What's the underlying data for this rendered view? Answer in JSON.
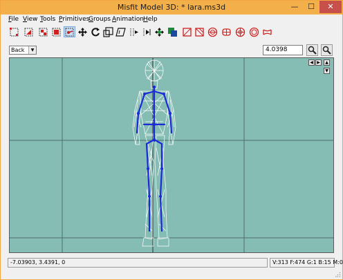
{
  "window": {
    "title": "Misfit Model 3D: * lara.ms3d",
    "controls": {
      "minimize": "—",
      "maximize": "☐",
      "close": "✕"
    }
  },
  "menu": {
    "items": [
      {
        "mn": "F",
        "rest": "ile"
      },
      {
        "mn": "V",
        "rest": "iew"
      },
      {
        "mn": "T",
        "rest": "ools"
      },
      {
        "mn": "P",
        "rest": "rimitives"
      },
      {
        "mn": "G",
        "rest": "roups"
      },
      {
        "mn": "A",
        "rest": "nimation"
      },
      {
        "mn": "H",
        "rest": "elp"
      }
    ]
  },
  "toolbar": {
    "tools": [
      "select-vertices-icon",
      "select-faces-icon",
      "select-connected-icon",
      "select-groups-icon",
      "select-bone-joints-icon",
      "move-icon",
      "rotate-icon",
      "scale-icon",
      "shear-icon",
      "extrude-icon",
      "attach-icon",
      "joint-icon",
      "rect-icon",
      "cube-icon",
      "ellipse-icon",
      "cylinder-icon",
      "torus-icon",
      "polygon-icon"
    ],
    "active_tool": "select-bone-joints-icon"
  },
  "options": {
    "view_select": "Back",
    "zoom_value": "4.0398"
  },
  "viewport": {
    "background": "#85bdb4",
    "nav": {
      "left": "◀",
      "right": "▶",
      "up": "▲",
      "down": "▼"
    }
  },
  "status": {
    "coordinates": "-7.03903, 3.4391, 0",
    "counts": "V:313 F:474 G:1 B:15 M:0"
  }
}
